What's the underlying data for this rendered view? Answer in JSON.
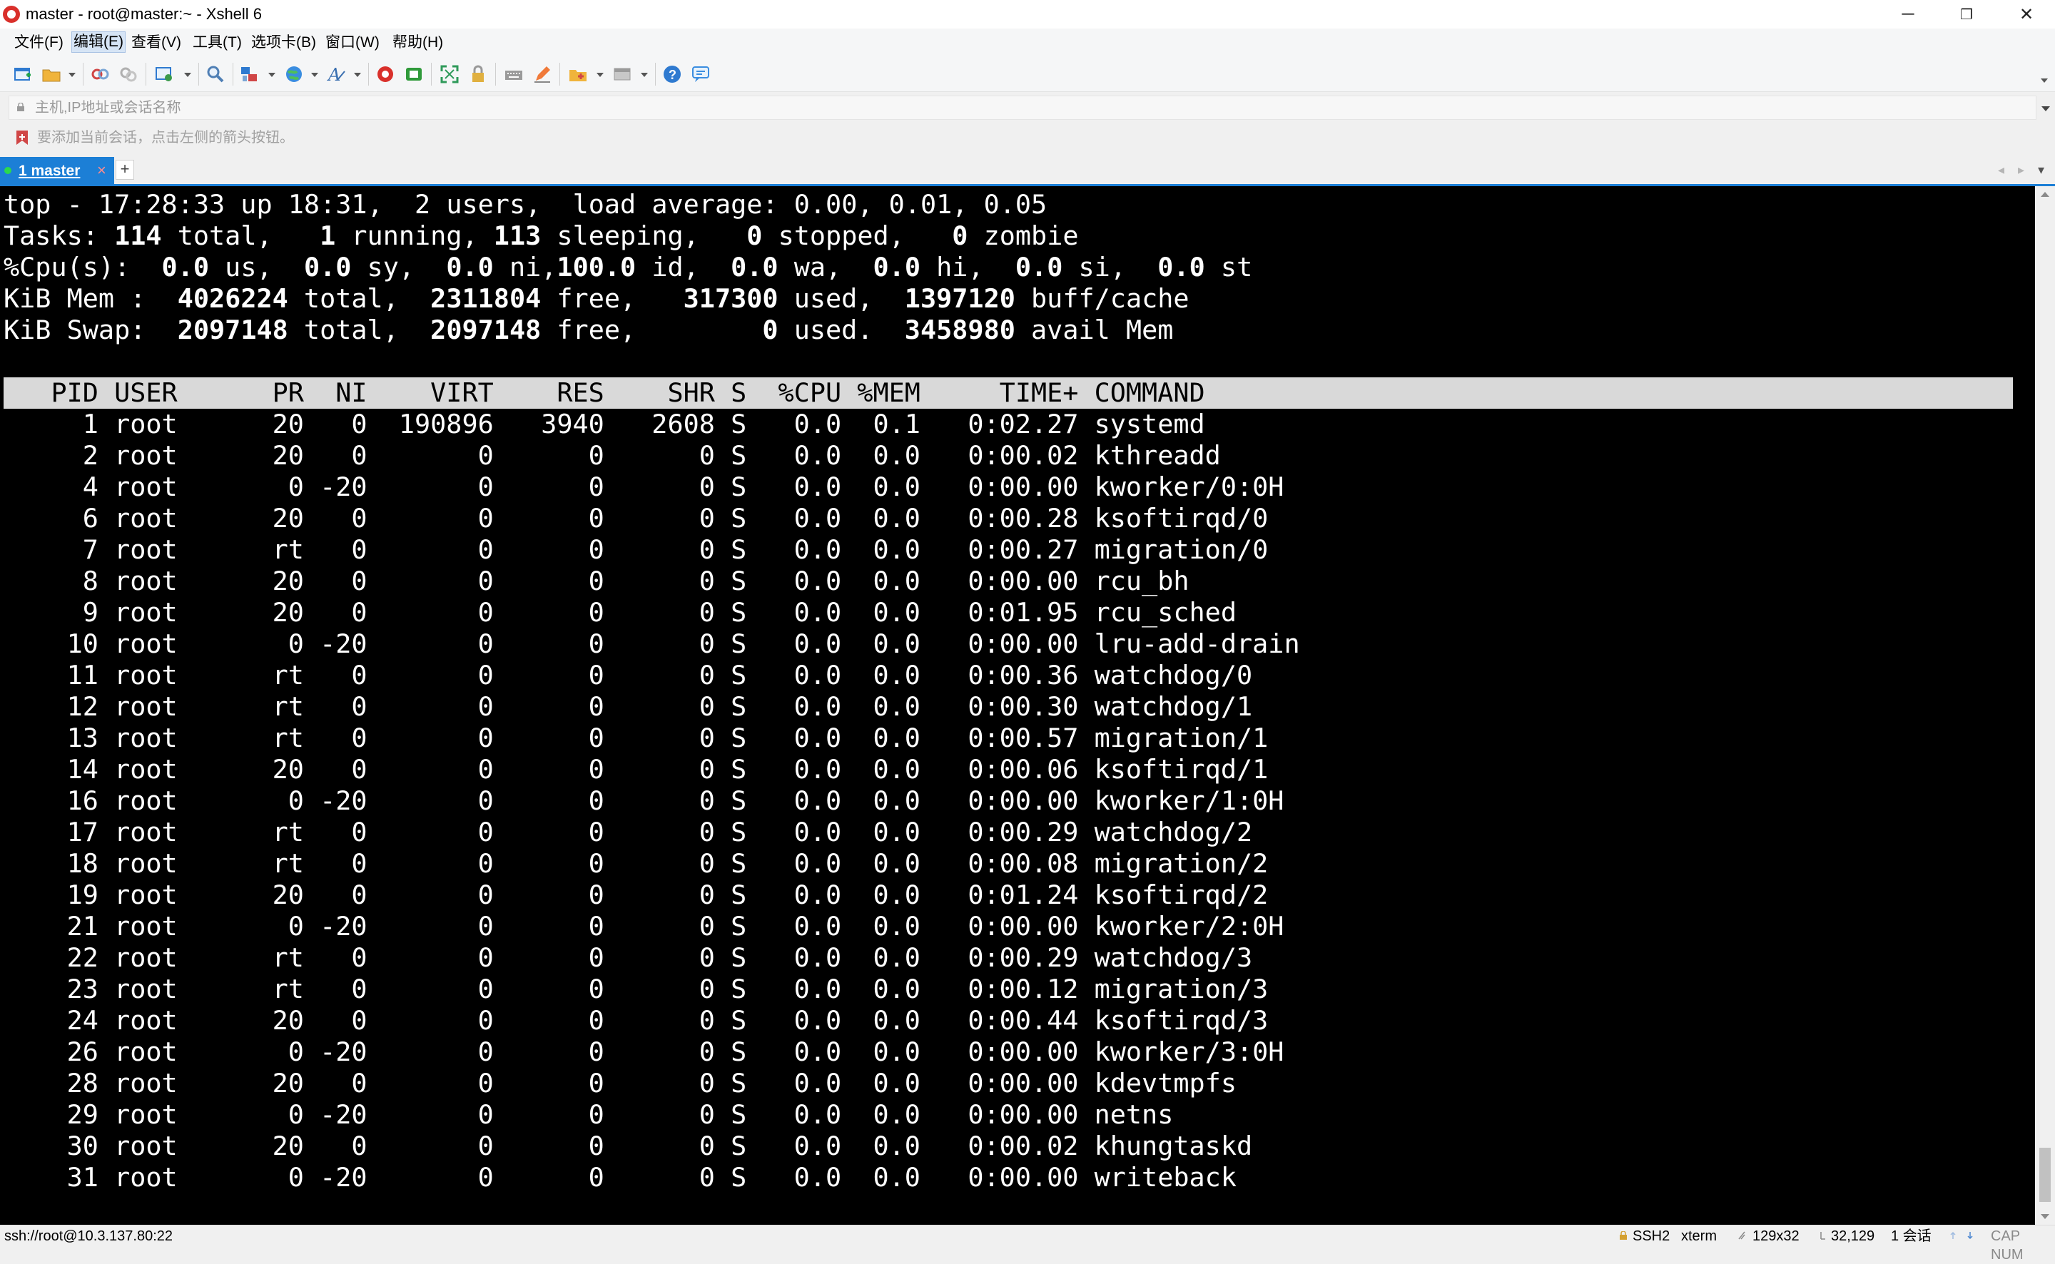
{
  "window": {
    "title": "master - root@master:~ - Xshell 6",
    "minimize_glyph": "─",
    "restore_glyph": "❐",
    "close_glyph": "✕"
  },
  "menu": [
    "文件(F)",
    "编辑(E)",
    "查看(V)",
    "工具(T)",
    "选项卡(B)",
    "窗口(W)",
    "帮助(H)"
  ],
  "toolbar_icons": [
    "new-session-icon",
    "open-folder-icon",
    "reconnect-icon",
    "disconnect-icon",
    "properties-icon",
    "find-icon",
    "transfer-icon",
    "globe-icon",
    "font-icon",
    "xshell-logo-icon",
    "xftp-icon",
    "fullscreen-icon",
    "lock-icon",
    "keyboard-icon",
    "compose-icon",
    "new-tab-icon",
    "layout-icon",
    "help-icon",
    "chat-icon"
  ],
  "address": {
    "placeholder": "主机,IP地址或会话名称"
  },
  "hint": {
    "text": "要添加当前会话，点击左侧的箭头按钮。"
  },
  "tab": {
    "label": "1 master",
    "close": "×",
    "add": "+",
    "prev": "◂",
    "next": "▸",
    "menu": "▾"
  },
  "terminal": {
    "summary": {
      "top": {
        "time": "17:28:33",
        "uptime": "18:31",
        "users": "2",
        "load": "0.00, 0.01, 0.05"
      },
      "tasks": {
        "total": "114",
        "running": "1",
        "sleeping": "113",
        "stopped": "0",
        "zombie": "0"
      },
      "cpu": {
        "us": "0.0",
        "sy": "0.0",
        "ni": "0.0",
        "id": "100.0",
        "wa": "0.0",
        "hi": "0.0",
        "si": "0.0",
        "st": "0.0"
      },
      "mem": {
        "total": "4026224",
        "free": "2311804",
        "used": "317300",
        "buff_cache": "1397120"
      },
      "swap": {
        "total": "2097148",
        "free": "2097148",
        "used": "0",
        "avail": "3458980"
      }
    },
    "columns": [
      "PID",
      "USER",
      "PR",
      "NI",
      "VIRT",
      "RES",
      "SHR",
      "S",
      "%CPU",
      "%MEM",
      "TIME+",
      "COMMAND"
    ],
    "processes": [
      [
        "1",
        "root",
        "20",
        "0",
        "190896",
        "3940",
        "2608",
        "S",
        "0.0",
        "0.1",
        "0:02.27",
        "systemd"
      ],
      [
        "2",
        "root",
        "20",
        "0",
        "0",
        "0",
        "0",
        "S",
        "0.0",
        "0.0",
        "0:00.02",
        "kthreadd"
      ],
      [
        "4",
        "root",
        "0",
        "-20",
        "0",
        "0",
        "0",
        "S",
        "0.0",
        "0.0",
        "0:00.00",
        "kworker/0:0H"
      ],
      [
        "6",
        "root",
        "20",
        "0",
        "0",
        "0",
        "0",
        "S",
        "0.0",
        "0.0",
        "0:00.28",
        "ksoftirqd/0"
      ],
      [
        "7",
        "root",
        "rt",
        "0",
        "0",
        "0",
        "0",
        "S",
        "0.0",
        "0.0",
        "0:00.27",
        "migration/0"
      ],
      [
        "8",
        "root",
        "20",
        "0",
        "0",
        "0",
        "0",
        "S",
        "0.0",
        "0.0",
        "0:00.00",
        "rcu_bh"
      ],
      [
        "9",
        "root",
        "20",
        "0",
        "0",
        "0",
        "0",
        "S",
        "0.0",
        "0.0",
        "0:01.95",
        "rcu_sched"
      ],
      [
        "10",
        "root",
        "0",
        "-20",
        "0",
        "0",
        "0",
        "S",
        "0.0",
        "0.0",
        "0:00.00",
        "lru-add-drain"
      ],
      [
        "11",
        "root",
        "rt",
        "0",
        "0",
        "0",
        "0",
        "S",
        "0.0",
        "0.0",
        "0:00.36",
        "watchdog/0"
      ],
      [
        "12",
        "root",
        "rt",
        "0",
        "0",
        "0",
        "0",
        "S",
        "0.0",
        "0.0",
        "0:00.30",
        "watchdog/1"
      ],
      [
        "13",
        "root",
        "rt",
        "0",
        "0",
        "0",
        "0",
        "S",
        "0.0",
        "0.0",
        "0:00.57",
        "migration/1"
      ],
      [
        "14",
        "root",
        "20",
        "0",
        "0",
        "0",
        "0",
        "S",
        "0.0",
        "0.0",
        "0:00.06",
        "ksoftirqd/1"
      ],
      [
        "16",
        "root",
        "0",
        "-20",
        "0",
        "0",
        "0",
        "S",
        "0.0",
        "0.0",
        "0:00.00",
        "kworker/1:0H"
      ],
      [
        "17",
        "root",
        "rt",
        "0",
        "0",
        "0",
        "0",
        "S",
        "0.0",
        "0.0",
        "0:00.29",
        "watchdog/2"
      ],
      [
        "18",
        "root",
        "rt",
        "0",
        "0",
        "0",
        "0",
        "S",
        "0.0",
        "0.0",
        "0:00.08",
        "migration/2"
      ],
      [
        "19",
        "root",
        "20",
        "0",
        "0",
        "0",
        "0",
        "S",
        "0.0",
        "0.0",
        "0:01.24",
        "ksoftirqd/2"
      ],
      [
        "21",
        "root",
        "0",
        "-20",
        "0",
        "0",
        "0",
        "S",
        "0.0",
        "0.0",
        "0:00.00",
        "kworker/2:0H"
      ],
      [
        "22",
        "root",
        "rt",
        "0",
        "0",
        "0",
        "0",
        "S",
        "0.0",
        "0.0",
        "0:00.29",
        "watchdog/3"
      ],
      [
        "23",
        "root",
        "rt",
        "0",
        "0",
        "0",
        "0",
        "S",
        "0.0",
        "0.0",
        "0:00.12",
        "migration/3"
      ],
      [
        "24",
        "root",
        "20",
        "0",
        "0",
        "0",
        "0",
        "S",
        "0.0",
        "0.0",
        "0:00.44",
        "ksoftirqd/3"
      ],
      [
        "26",
        "root",
        "0",
        "-20",
        "0",
        "0",
        "0",
        "S",
        "0.0",
        "0.0",
        "0:00.00",
        "kworker/3:0H"
      ],
      [
        "28",
        "root",
        "20",
        "0",
        "0",
        "0",
        "0",
        "S",
        "0.0",
        "0.0",
        "0:00.00",
        "kdevtmpfs"
      ],
      [
        "29",
        "root",
        "0",
        "-20",
        "0",
        "0",
        "0",
        "S",
        "0.0",
        "0.0",
        "0:00.00",
        "netns"
      ],
      [
        "30",
        "root",
        "20",
        "0",
        "0",
        "0",
        "0",
        "S",
        "0.0",
        "0.0",
        "0:00.02",
        "khungtaskd"
      ],
      [
        "31",
        "root",
        "0",
        "-20",
        "0",
        "0",
        "0",
        "S",
        "0.0",
        "0.0",
        "0:00.00",
        "writeback"
      ]
    ]
  },
  "status": {
    "connection": "ssh://root@10.3.137.80:22",
    "protocol": "SSH2",
    "terminal_type": "xterm",
    "size": "129x32",
    "cursor": "32,129",
    "sessions": "1 会话",
    "caps": "CAP NUM"
  },
  "colors": {
    "accent": "#1c7fd6",
    "terminal_bg": "#000000",
    "terminal_fg": "#ffffff",
    "header_bg": "#d9d9d9"
  }
}
